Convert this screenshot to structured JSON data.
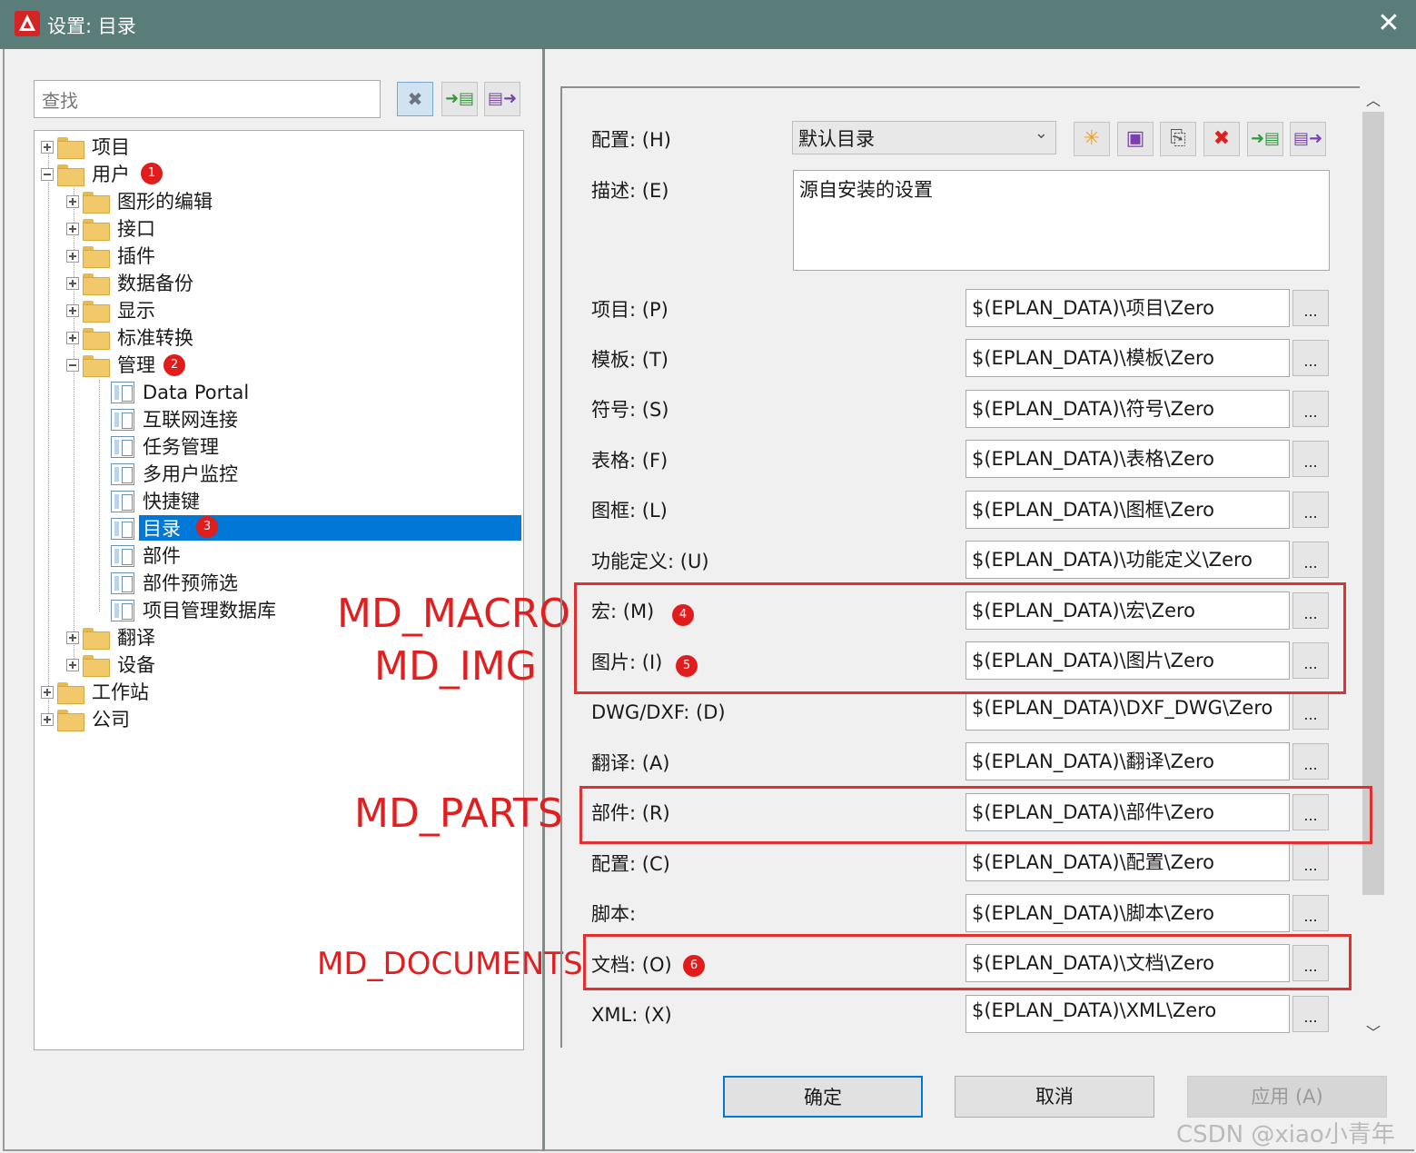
{
  "window": {
    "title": "设置: 目录",
    "close_glyph": "✕"
  },
  "search": {
    "placeholder": "查找"
  },
  "tree": {
    "project": "项目",
    "user": "用户",
    "graphic_edit": "图形的编辑",
    "interface": "接口",
    "plugin": "插件",
    "data_backup": "数据备份",
    "display": "显示",
    "std_convert": "标准转换",
    "management": "管理",
    "data_portal": "Data Portal",
    "internet": "互联网连接",
    "task_mgmt": "任务管理",
    "multi_user": "多用户监控",
    "shortcut": "快捷键",
    "directory": "目录",
    "parts": "部件",
    "parts_filter": "部件预筛选",
    "project_db": "项目管理数据库",
    "translate": "翻译",
    "device": "设备",
    "workstation": "工作站",
    "company": "公司"
  },
  "badges": [
    "1",
    "2",
    "3",
    "4",
    "5",
    "6"
  ],
  "annotations": {
    "macro": "MD_MACRO",
    "img": "MD_IMG",
    "parts": "MD_PARTS",
    "documents": "MD_DOCUMENTS"
  },
  "config": {
    "label": "配置: (H)",
    "value": "默认目录",
    "desc_label": "描述: (E)",
    "desc_value": "源自安装的设置"
  },
  "fields": [
    {
      "label": "项目: (P)",
      "value": "$(EPLAN_DATA)\\项目\\Zero"
    },
    {
      "label": "模板: (T)",
      "value": "$(EPLAN_DATA)\\模板\\Zero"
    },
    {
      "label": "符号: (S)",
      "value": "$(EPLAN_DATA)\\符号\\Zero"
    },
    {
      "label": "表格: (F)",
      "value": "$(EPLAN_DATA)\\表格\\Zero"
    },
    {
      "label": "图框: (L)",
      "value": "$(EPLAN_DATA)\\图框\\Zero"
    },
    {
      "label": "功能定义: (U)",
      "value": "$(EPLAN_DATA)\\功能定义\\Zero"
    },
    {
      "label": "宏: (M)",
      "value": "$(EPLAN_DATA)\\宏\\Zero"
    },
    {
      "label": "图片: (I)",
      "value": "$(EPLAN_DATA)\\图片\\Zero"
    },
    {
      "label": "DWG/DXF: (D)",
      "value": "$(EPLAN_DATA)\\DXF_DWG\\Zero"
    },
    {
      "label": "翻译: (A)",
      "value": "$(EPLAN_DATA)\\翻译\\Zero"
    },
    {
      "label": "部件: (R)",
      "value": "$(EPLAN_DATA)\\部件\\Zero"
    },
    {
      "label": "配置: (C)",
      "value": "$(EPLAN_DATA)\\配置\\Zero"
    },
    {
      "label": "脚本:",
      "value": "$(EPLAN_DATA)\\脚本\\Zero"
    },
    {
      "label": "文档: (O)",
      "value": "$(EPLAN_DATA)\\文档\\Zero"
    },
    {
      "label": "XML: (X)",
      "value": "$(EPLAN_DATA)\\XML\\Zero"
    }
  ],
  "browse_label": "...",
  "buttons": {
    "ok": "确定",
    "cancel": "取消",
    "apply": "应用 (A)"
  },
  "watermark": "CSDN @xiao小青年",
  "colors": {
    "titlebar": "#5a7d79",
    "selection": "#0078d7",
    "annotation": "#e02020",
    "badge": "#e01c1c"
  }
}
